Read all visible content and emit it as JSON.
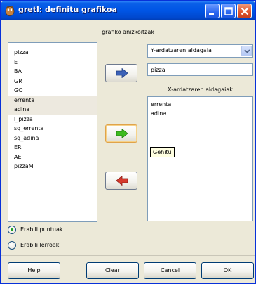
{
  "window": {
    "title": "gretl: definitu grafikoa",
    "title_bar_color": "#0055e5"
  },
  "section_label": "grafiko anizkoitzak",
  "variables": [
    "pizza",
    "E",
    "BA",
    "GR",
    "GO",
    "errenta",
    "adina",
    "l_pizza",
    "sq_errenta",
    "sq_adina",
    "ER",
    "AE",
    "pizzaM"
  ],
  "selected_variables": [
    "errenta",
    "adina"
  ],
  "y_axis": {
    "selector_value": "Y-ardatzaren aldagaia",
    "entry_value": "pizza"
  },
  "x_axis": {
    "label": "X-ardatzaren aldagaiak",
    "items": [
      "errenta",
      "adina"
    ]
  },
  "tooltip": "Gehitu",
  "icons": {
    "y_add": "arrow-right-blue-icon",
    "x_add": "arrow-right-green-icon",
    "x_remove": "arrow-left-red-icon",
    "add_green": "#3dbb1f",
    "remove_red": "#d63a2d",
    "add_blue": "#3b61b8"
  },
  "options": {
    "points": {
      "label": "Erabili puntuak",
      "checked": true
    },
    "lines": {
      "label": "Erabili lerroak",
      "checked": false
    }
  },
  "buttons": {
    "help_u": "H",
    "help_rest": "elp",
    "clear_u": "C",
    "clear_rest": "lear",
    "cancel_u": "C",
    "cancel_rest": "ancel",
    "ok_u": "O",
    "ok_rest": "K"
  }
}
